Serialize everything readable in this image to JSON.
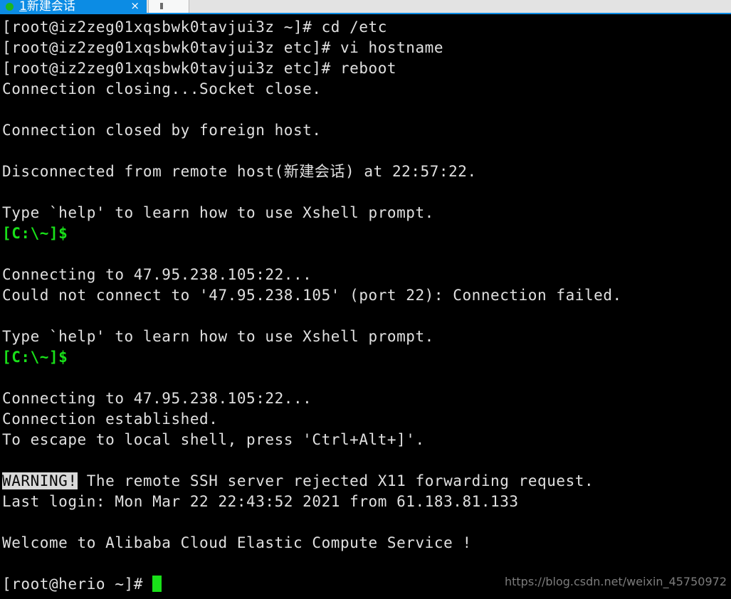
{
  "app": {
    "name": "Xshell",
    "accent_color": "#0c8ce4",
    "terminal_bg": "#000000",
    "terminal_fg": "#e0e0e0",
    "prompt_green": "#19e019",
    "status_dot_color": "#1db520"
  },
  "tab_bar": {
    "tabs": [
      {
        "index_label": "1",
        "label": "新建会话",
        "close_label": "×",
        "active": true,
        "status": "connected"
      },
      {
        "index_label": "",
        "label": "",
        "active": false
      }
    ]
  },
  "terminal": {
    "host_old": "iz2zeg01xqsbwk0tavjui3z",
    "host_new": "herio",
    "server_ip": "47.95.238.105",
    "port": "22",
    "lines": [
      {
        "text": "[root@iz2zeg01xqsbwk0tavjui3z ~]# cd /etc"
      },
      {
        "text": "[root@iz2zeg01xqsbwk0tavjui3z etc]# vi hostname"
      },
      {
        "text": "[root@iz2zeg01xqsbwk0tavjui3z etc]# reboot"
      },
      {
        "text": "Connection closing...Socket close."
      },
      {
        "text": ""
      },
      {
        "text": "Connection closed by foreign host."
      },
      {
        "text": ""
      },
      {
        "text": "Disconnected from remote host(新建会话) at 22:57:22."
      },
      {
        "text": ""
      },
      {
        "text": "Type `help' to learn how to use Xshell prompt."
      },
      {
        "text": "[C:\\~]$",
        "style": "green"
      },
      {
        "text": ""
      },
      {
        "text": "Connecting to 47.95.238.105:22..."
      },
      {
        "text": "Could not connect to '47.95.238.105' (port 22): Connection failed."
      },
      {
        "text": ""
      },
      {
        "text": "Type `help' to learn how to use Xshell prompt."
      },
      {
        "text": "[C:\\~]$",
        "style": "green"
      },
      {
        "text": ""
      },
      {
        "text": "Connecting to 47.95.238.105:22..."
      },
      {
        "text": "Connection established."
      },
      {
        "text": "To escape to local shell, press 'Ctrl+Alt+]'."
      },
      {
        "text": ""
      },
      {
        "text": "",
        "segments": [
          {
            "text": "WARNING!",
            "style": "inverse"
          },
          {
            "text": " The remote SSH server rejected X11 forwarding request."
          }
        ]
      },
      {
        "text": "Last login: Mon Mar 22 22:43:52 2021 from 61.183.81.133"
      },
      {
        "text": ""
      },
      {
        "text": "Welcome to Alibaba Cloud Elastic Compute Service !"
      },
      {
        "text": ""
      },
      {
        "text": "[root@herio ~]# ",
        "cursor": true
      }
    ]
  },
  "watermark": {
    "text": "https://blog.csdn.net/weixin_45750972"
  }
}
